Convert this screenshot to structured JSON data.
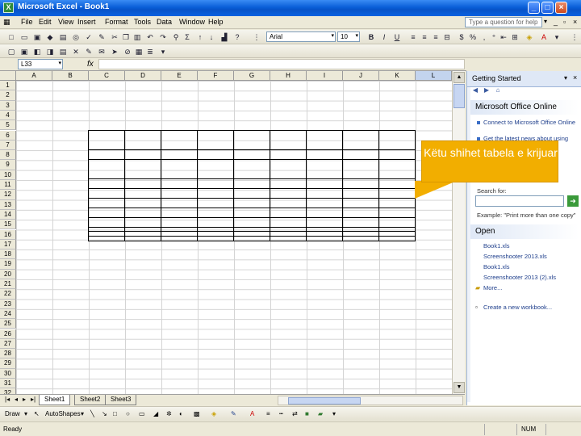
{
  "window": {
    "title": "Microsoft Excel - Book1",
    "app_icon": "X",
    "colors": {
      "titlebar": "#0a5fd8",
      "callout": "#f2ae00"
    }
  },
  "menu": {
    "items": [
      "File",
      "Edit",
      "View",
      "Insert",
      "Format",
      "Tools",
      "Data",
      "Window",
      "Help"
    ],
    "help_placeholder": "Type a question for help"
  },
  "format_toolbar": {
    "font_name": "Arial",
    "font_size": "10"
  },
  "formula_bar": {
    "name_box": "L33",
    "fx": "fx"
  },
  "sheet": {
    "columns": [
      "A",
      "B",
      "C",
      "D",
      "E",
      "F",
      "G",
      "H",
      "I",
      "J",
      "K",
      "L"
    ],
    "selected_column": "L",
    "rows": [
      "1",
      "2",
      "3",
      "4",
      "5",
      "6",
      "7",
      "8",
      "9",
      "10",
      "11",
      "12",
      "13",
      "14",
      "15",
      "16",
      "17",
      "18",
      "19",
      "20",
      "21",
      "22",
      "23",
      "24",
      "25",
      "26",
      "27",
      "28",
      "29",
      "30",
      "31",
      "32"
    ],
    "tabs": [
      "Sheet1",
      "Sheet2",
      "Sheet3"
    ],
    "active_tab": "Sheet1"
  },
  "draw_toolbar": {
    "draw_label": "Draw",
    "autoshapes_label": "AutoShapes"
  },
  "status": {
    "text": "Ready",
    "num": "NUM"
  },
  "task_pane": {
    "title": "Getting Started",
    "online_heading": "Microsoft Office Online",
    "links": [
      "Connect to Microsoft Office Online",
      "Get the latest news about using Excel"
    ],
    "search_label": "Search for:",
    "example": "Example: \"Print more than one copy\"",
    "open_heading": "Open",
    "files": [
      "Book1.xls",
      "Screenshooter 2013.xls",
      "Book1.xls",
      "Screenshooter 2013 (2).xls"
    ],
    "more": "More...",
    "create_new": "Create a new workbook..."
  },
  "callout": {
    "text": "Këtu shihet tabela e krijuar"
  }
}
